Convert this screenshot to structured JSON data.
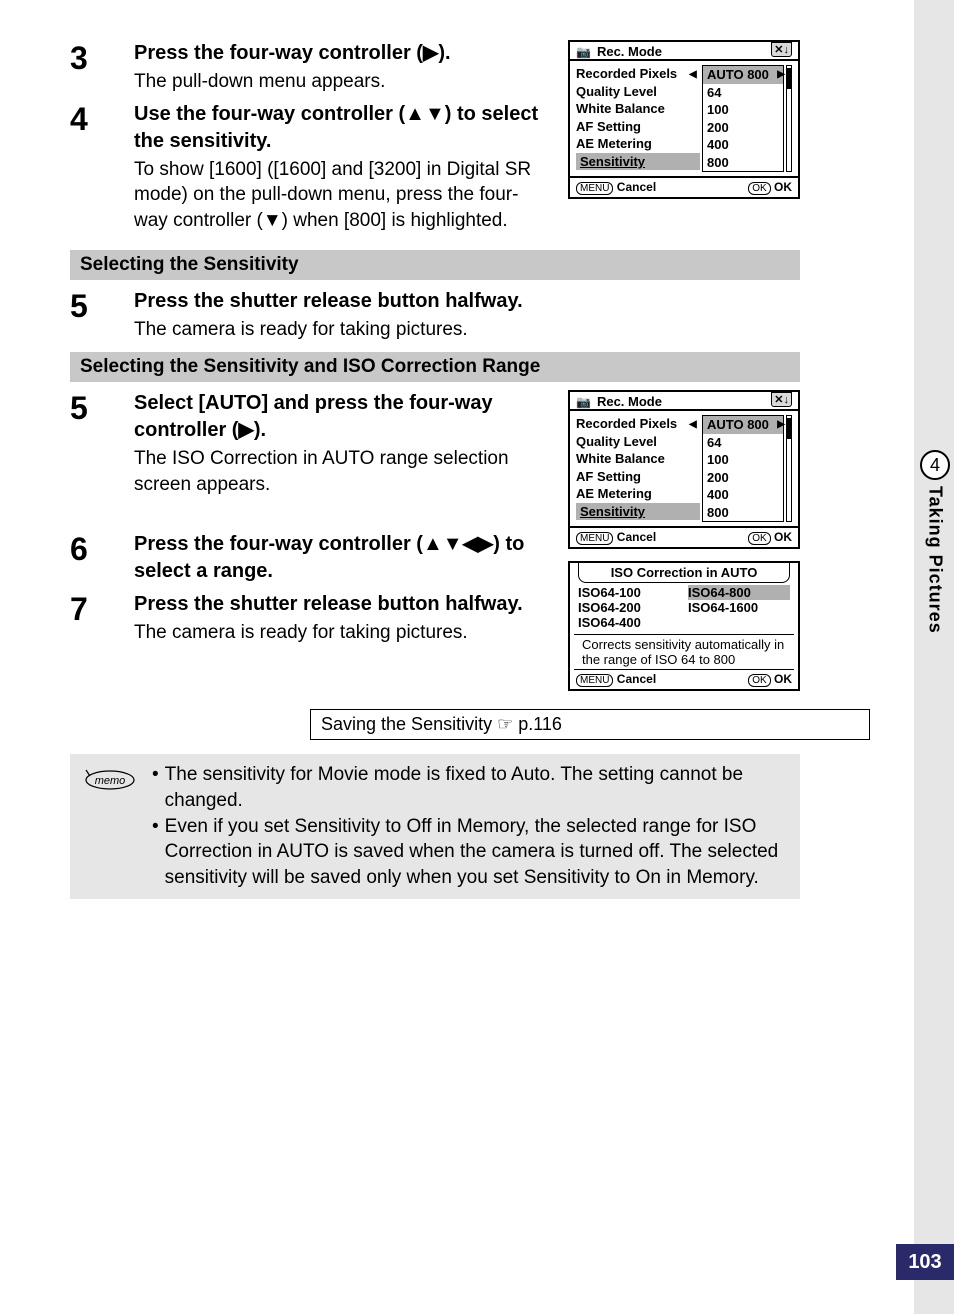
{
  "sideTab": {
    "number": "4",
    "title": "Taking Pictures"
  },
  "pageNumber": "103",
  "steps": {
    "s3": {
      "num": "3",
      "title": "Press the four-way controller (▶).",
      "desc": "The pull-down menu appears."
    },
    "s4": {
      "num": "4",
      "title": "Use the four-way controller (▲▼) to select the sensitivity.",
      "desc": "To show [1600] ([1600] and [3200] in Digital SR mode) on the pull-down menu,  press the four-way controller (▼) when [800] is highlighted."
    },
    "bar1": "Selecting the Sensitivity",
    "s5a": {
      "num": "5",
      "title": "Press the shutter release button halfway.",
      "desc": "The camera is ready for taking pictures."
    },
    "bar2": "Selecting the Sensitivity and ISO Correction Range",
    "s5b": {
      "num": "5",
      "title": "Select [AUTO] and press the four-way controller (▶).",
      "desc": "The ISO Correction in AUTO range selection screen appears."
    },
    "s6": {
      "num": "6",
      "title": "Press the four-way controller (▲▼◀▶) to select a range."
    },
    "s7": {
      "num": "7",
      "title": "Press the shutter release button halfway.",
      "desc": "The camera is ready for taking pictures."
    }
  },
  "lcd": {
    "title": "Rec. Mode",
    "labels": [
      "Recorded Pixels",
      "Quality Level",
      "White Balance",
      "AF Setting",
      "AE Metering",
      "Sensitivity"
    ],
    "values": [
      "AUTO 800",
      "64",
      "100",
      "200",
      "400",
      "800"
    ],
    "footer": {
      "menu": "MENU",
      "cancel": "Cancel",
      "ok1": "OK",
      "ok2": "OK"
    }
  },
  "isoLcd": {
    "title": "ISO Correction in AUTO",
    "options": [
      "ISO64-100",
      "ISO64-800",
      "ISO64-200",
      "ISO64-1600",
      "ISO64-400"
    ],
    "desc": "Corrects sensitivity automatically in the range of ISO 64 to 800",
    "footer": {
      "menu": "MENU",
      "cancel": "Cancel",
      "ok1": "OK",
      "ok2": "OK"
    }
  },
  "crossRef": "Saving the Sensitivity ☞ p.116",
  "memo": {
    "label": "memo",
    "b1": "The sensitivity for Movie mode is fixed to Auto. The setting cannot be changed.",
    "b2": "Even if you set Sensitivity to Off in Memory, the selected range for ISO Correction in AUTO is saved when the camera is turned off. The selected sensitivity will be saved only when you set Sensitivity to On in Memory."
  }
}
